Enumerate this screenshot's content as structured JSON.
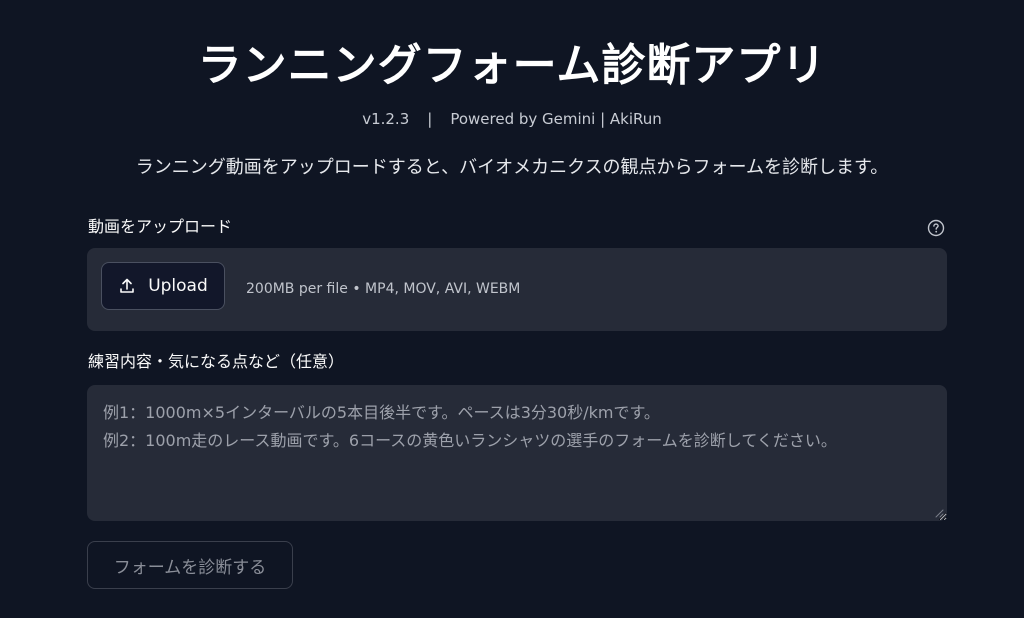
{
  "header": {
    "title": "ランニングフォーム診断アプリ",
    "version": "v1.2.3",
    "separator": "|",
    "powered_by": "Powered by Gemini | AkiRun",
    "description": "ランニング動画をアップロードすると、バイオメカニクスの観点からフォームを診断します。"
  },
  "upload": {
    "label": "動画をアップロード",
    "help_icon": "question-circle-icon",
    "button_label": "Upload",
    "button_icon": "upload-icon",
    "limits": "200MB per file • MP4, MOV, AVI, WEBM"
  },
  "notes": {
    "label": "練習内容・気になる点など（任意）",
    "value": "",
    "placeholder": "例1：1000m×5インターバルの5本目後半です。ペースは3分30秒/kmです。\n例2：100m走のレース動画です。6コースの黄色いランシャツの選手のフォームを診断してください。"
  },
  "submit": {
    "label": "フォームを診断する",
    "enabled": false
  },
  "colors": {
    "background": "#0f1523",
    "panel": "#262b38",
    "text": "#fafafa",
    "muted": "#9da1ab"
  }
}
